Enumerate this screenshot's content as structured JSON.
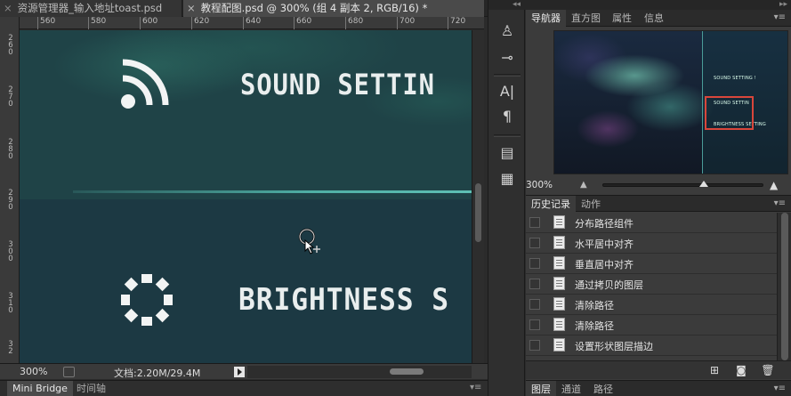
{
  "document_tabs": [
    {
      "label": "资源管理器_输入地址toast.psd",
      "close": "×",
      "active": false
    },
    {
      "label": "教程配图.psd @ 300% (组 4 副本 2, RGB/16) *",
      "close": "×",
      "active": true
    }
  ],
  "ruler": {
    "horizontal": [
      "560",
      "580",
      "600",
      "620",
      "640",
      "660",
      "680",
      "700",
      "720"
    ],
    "vertical": [
      [
        "2",
        "6",
        "0"
      ],
      [
        "2",
        "7",
        "0"
      ],
      [
        "2",
        "8",
        "0"
      ],
      [
        "2",
        "9",
        "0"
      ],
      [
        "3",
        "0",
        "0"
      ],
      [
        "3",
        "1",
        "0"
      ],
      [
        "3",
        "2",
        "0"
      ]
    ]
  },
  "canvas": {
    "sound_label": "SOUND SETTIN",
    "brightness_label": "BRIGHTNESS S",
    "icons": [
      "wifi-sound-icon",
      "brightness-icon",
      "zoom-cursor-icon"
    ]
  },
  "status_bar": {
    "zoom": "300%",
    "doc_size": "文档:2.20M/29.4M"
  },
  "bottom_panel": {
    "tabs": [
      "Mini Bridge",
      "时间轴"
    ],
    "menu": "▾≡"
  },
  "tool_strip": {
    "collapse": "◂◂",
    "icons": [
      "brush-preset-icon",
      "brush-settings-icon",
      "character-icon",
      "paragraph-icon",
      "notes-icon",
      "properties-doc-icon"
    ],
    "glyphs": [
      "♙",
      "⊸",
      "A|",
      "¶",
      "▤",
      "▦"
    ]
  },
  "navigator": {
    "collapse": "▸▸",
    "tabs": [
      "导航器",
      "直方图",
      "属性",
      "信息"
    ],
    "menu": "▾≡",
    "zoom": "300%",
    "zoom_out": "▲",
    "zoom_in": "▲",
    "zoom_fraction": 0.63,
    "thumb_labels": [
      "SOUND SETTING !",
      "SOUND SETTIN",
      "BRIGHTNESS SETTING"
    ],
    "highlight_color": "#d9463b"
  },
  "history": {
    "tabs": [
      "历史记录",
      "动作"
    ],
    "menu": "▾≡",
    "items": [
      "分布路径组件",
      "水平居中对齐",
      "垂直居中对齐",
      "通过拷贝的图层",
      "清除路径",
      "清除路径",
      "设置形状图层描边"
    ],
    "footer_icons": [
      "new-document-from-state-icon",
      "snapshot-camera-icon",
      "trash-icon"
    ],
    "footer_glyphs": [
      "⊞",
      "◙",
      "🗑"
    ]
  },
  "layers": {
    "tabs": [
      "图层",
      "通道",
      "路径"
    ],
    "menu": "▾≡"
  },
  "colors": {
    "canvas_bg": "#1f4347",
    "divider": "#4fb0a5",
    "panel_bg": "#3b3b3b"
  }
}
